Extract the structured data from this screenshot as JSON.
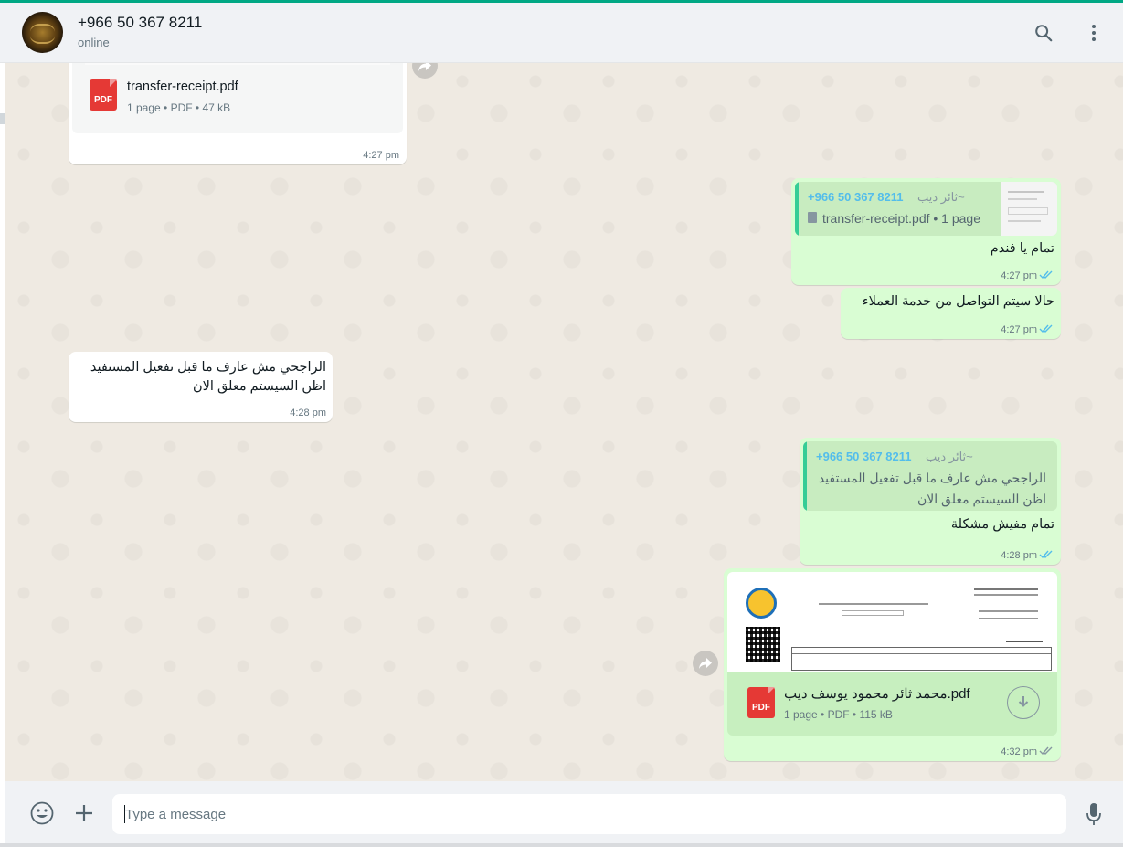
{
  "header": {
    "contact_name": "+966 50 367 8211",
    "status": "online",
    "search_icon": "search-icon",
    "menu_icon": "kebab-menu-icon"
  },
  "messages": {
    "m1": {
      "file_name": "transfer-receipt.pdf",
      "pages": "1 page",
      "type": "PDF",
      "size": "47 kB",
      "time": "4:27 pm",
      "badge": "PDF"
    },
    "m2": {
      "quote_phone": "+966 50 367 8211",
      "quote_name": "~ثائر ديب",
      "quote_file": "transfer-receipt.pdf • 1 page",
      "text": "تمام يا فندم",
      "time": "4:27 pm"
    },
    "m3": {
      "text": "حالا سيتم التواصل من خدمة العملاء",
      "time": "4:27 pm"
    },
    "m4": {
      "line1": "الراجحي مش عارف ما قبل تفعيل المستفيد",
      "line2": "اظن السيستم معلق الان",
      "time": "4:28 pm"
    },
    "m5": {
      "quote_phone": "+966 50 367 8211",
      "quote_name": "~ثائر ديب",
      "quote_line1": "الراجحي مش عارف ما قبل تفعيل المستفيد",
      "quote_line2": "اظن السيستم معلق الان",
      "text": "تمام مفيش مشكلة",
      "time": "4:28 pm"
    },
    "m6": {
      "file_name": "محمد ثائر محمود يوسف ديب.pdf",
      "pages": "1 page",
      "type": "PDF",
      "size": "115 kB",
      "time": "4:32 pm",
      "badge": "PDF"
    }
  },
  "composer": {
    "placeholder": "Type a message",
    "emoji_icon": "emoji-icon",
    "attach_icon": "plus-icon",
    "mic_icon": "microphone-icon"
  },
  "colors": {
    "accent": "#00a884",
    "incoming": "#ffffff",
    "outgoing": "#d9fdd3",
    "read_ticks": "#53bdeb",
    "pdf_red": "#e53935"
  }
}
